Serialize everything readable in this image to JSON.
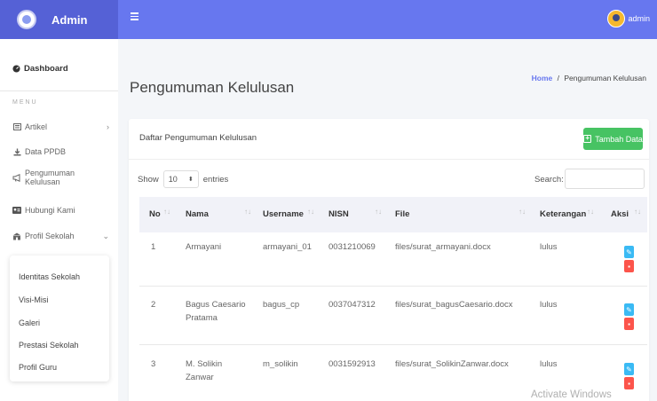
{
  "brand": {
    "name": "Admin",
    "logo_icon": "school-logo"
  },
  "topbar": {
    "menu_icon": "hamburger-icon",
    "user_name": "admin"
  },
  "sidebar": {
    "dashboard": "Dashboard",
    "menu_header": "MENU",
    "items": [
      {
        "label": "Artikel",
        "icon": "newspaper-icon",
        "has_children": true
      },
      {
        "label": "Data PPDB",
        "icon": "download-icon"
      },
      {
        "label": "Pengumuman Kelulusan",
        "icon": "megaphone-icon"
      },
      {
        "label": "Hubungi Kami",
        "icon": "contact-card-icon"
      },
      {
        "label": "Profil Sekolah",
        "icon": "school-icon",
        "has_children": true,
        "expanded": true
      }
    ],
    "submenu": [
      "Identitas Sekolah",
      "Visi-Misi",
      "Galeri",
      "Prestasi Sekolah",
      "Profil Guru"
    ]
  },
  "page": {
    "title": "Pengumuman Kelulusan",
    "breadcrumb": {
      "home": "Home",
      "separator": "/",
      "current": "Pengumuman Kelulusan"
    }
  },
  "card": {
    "title": "Daftar Pengumuman Kelulusan",
    "add_button": "Tambah Data",
    "show_label": "Show",
    "entries_value": "10",
    "entries_label": "entries",
    "search_label": "Search:",
    "search_value": ""
  },
  "table": {
    "columns": [
      "No",
      "Nama",
      "Username",
      "NISN",
      "File",
      "Keterangan",
      "Aksi"
    ],
    "rows": [
      {
        "no": "1",
        "nama": "Armayani",
        "username": "armayani_01",
        "nisn": "0031210069",
        "file": "files/surat_armayani.docx",
        "keterangan": "lulus"
      },
      {
        "no": "2",
        "nama": "Bagus Caesario Pratama",
        "username": "bagus_cp",
        "nisn": "0037047312",
        "file": "files/surat_bagusCaesario.docx",
        "keterangan": "lulus"
      },
      {
        "no": "3",
        "nama": "M. Solikin Zanwar",
        "username": "m_solikin",
        "nisn": "0031592913",
        "file": "files/surat_SolikinZanwar.docx",
        "keterangan": "lulus"
      }
    ]
  },
  "overlay": {
    "watermark": "Activate Windows"
  },
  "colors": {
    "primary": "#6777ef",
    "success": "#47c363",
    "info": "#3abaf4",
    "danger": "#fc544b"
  }
}
